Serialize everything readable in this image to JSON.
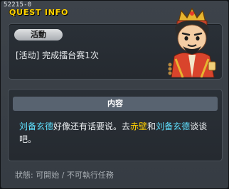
{
  "window": {
    "quest_id": "52215-0",
    "title": "QUEST INFO"
  },
  "quest": {
    "category_badge": "活動",
    "name": "[活动] 完成擂台赛1次"
  },
  "content": {
    "header": "内容",
    "desc": {
      "npc1": "刘备玄德",
      "text1": "好像还有话要说。去",
      "place": "赤壁",
      "text2": "和",
      "npc2": "刘备玄德",
      "text3": "谈谈吧。"
    }
  },
  "status": {
    "text": "狀態: 可開始 / 不可執行任務"
  },
  "colors": {
    "title": "#ffd300",
    "npc_highlight": "#5fe0ff",
    "place_highlight": "#ffd000",
    "content_header_bg": "#586370"
  },
  "icons": {
    "portrait": "liu-bei-npc-portrait"
  }
}
